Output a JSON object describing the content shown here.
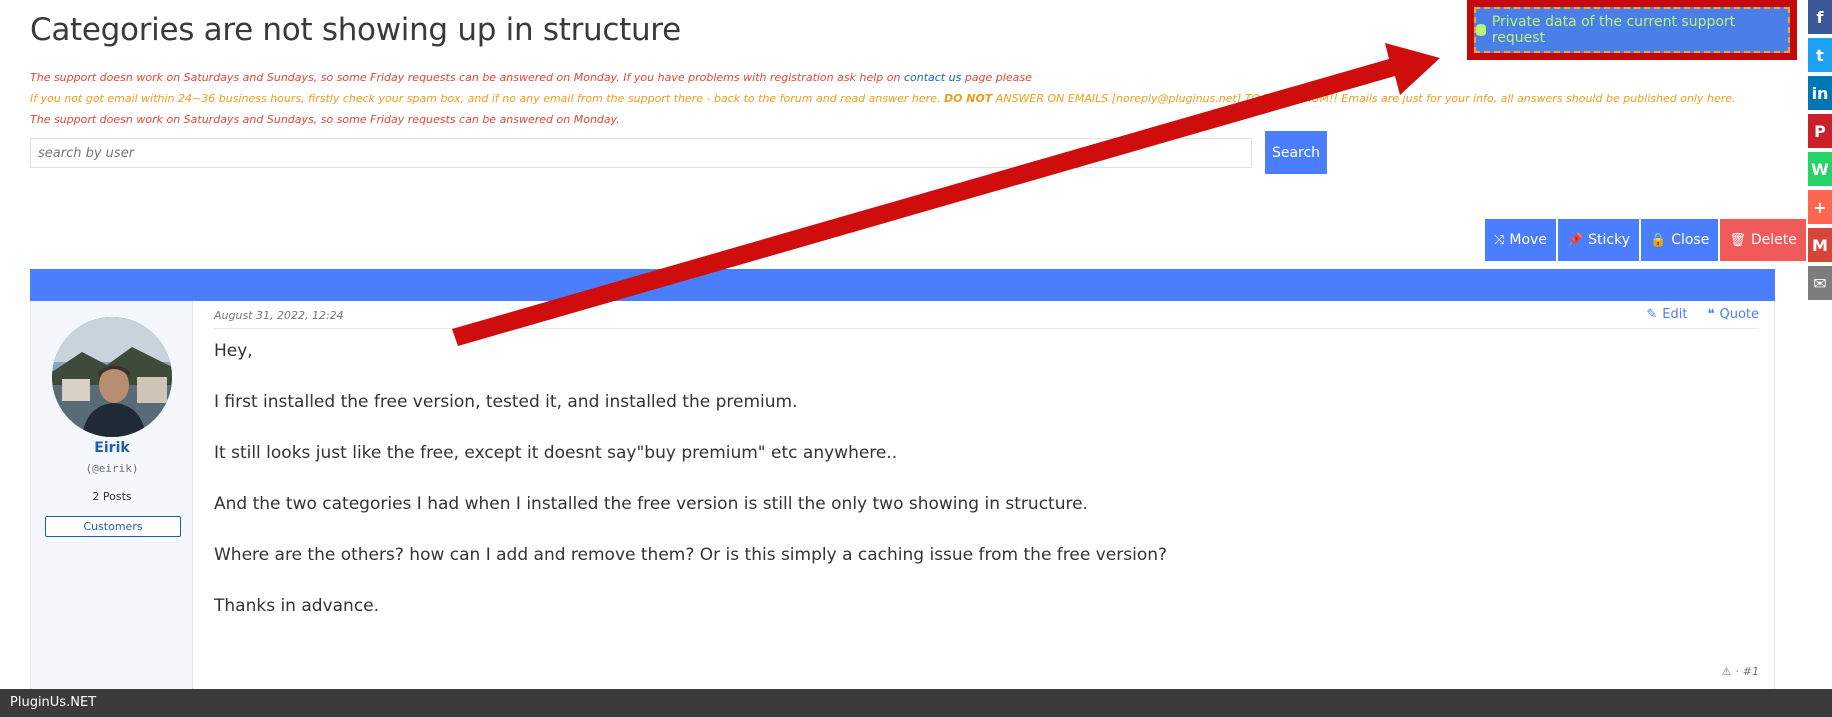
{
  "page": {
    "title": "Categories are not showing up in structure"
  },
  "private_button": {
    "label": "Private data of the current support request",
    "icon": "database-icon",
    "accent": "#b8f576",
    "bg": "#4a7ee8",
    "highlight_border": "#c4080b"
  },
  "notices": {
    "line1_text": "The support doesn work on Saturdays and Sundays, so some Friday requests can be answered on Monday. If you have problems with registration ask help on ",
    "line1_link": "contact us",
    "line1_tail": " page please",
    "line2_text": "If you not got email within 24~36 business hours, firstly check your spam box, and if no any email from the support there - back to the forum and read answer here. ",
    "line2_bold": "DO NOT",
    "line2_tail": " ANSWER ON EMAILS [noreply@pluginus.net] TO THE FORUM!! Emails are just for your info, all answers should be published only here.",
    "line3_text": "The support doesn work on Saturdays and Sundays, so some Friday requests can be answered on Monday."
  },
  "search": {
    "placeholder": "search by user",
    "button_label": "Search"
  },
  "actions": {
    "move": "Move",
    "sticky": "Sticky",
    "close": "Close",
    "delete": "Delete"
  },
  "post": {
    "date": "August 31, 2022, 12:24",
    "edit_label": "Edit",
    "quote_label": "Quote",
    "author": {
      "name": "Eirik",
      "handle": "(@eirik)",
      "posts": "2 Posts",
      "role": "Customers"
    },
    "paragraphs": [
      "Hey,",
      "I first installed the free version, tested it, and installed the premium.",
      "It still looks just like the free, except it doesnt say\"buy premium\" etc anywhere..",
      "And the two categories I had when I installed the free version is still the only two showing in structure.",
      "Where are the others? how can I add and remove them? Or is this simply a caching issue from the free version?",
      "Thanks in advance."
    ],
    "number": "#1"
  },
  "share": [
    {
      "icon": "facebook-icon",
      "glyph": "f",
      "color": "#3b5998"
    },
    {
      "icon": "twitter-icon",
      "glyph": "t",
      "color": "#1da1f2"
    },
    {
      "icon": "linkedin-icon",
      "glyph": "in",
      "color": "#0077b5"
    },
    {
      "icon": "pinterest-icon",
      "glyph": "P",
      "color": "#cb2027"
    },
    {
      "icon": "whatsapp-icon",
      "glyph": "W",
      "color": "#25d366"
    },
    {
      "icon": "plus-icon",
      "glyph": "+",
      "color": "#ff6550"
    },
    {
      "icon": "gmail-icon",
      "glyph": "M",
      "color": "#d44638"
    },
    {
      "icon": "email-icon",
      "glyph": "✉",
      "color": "#7d7d7d"
    }
  ],
  "footer": {
    "brand": "PluginUs.NET"
  }
}
